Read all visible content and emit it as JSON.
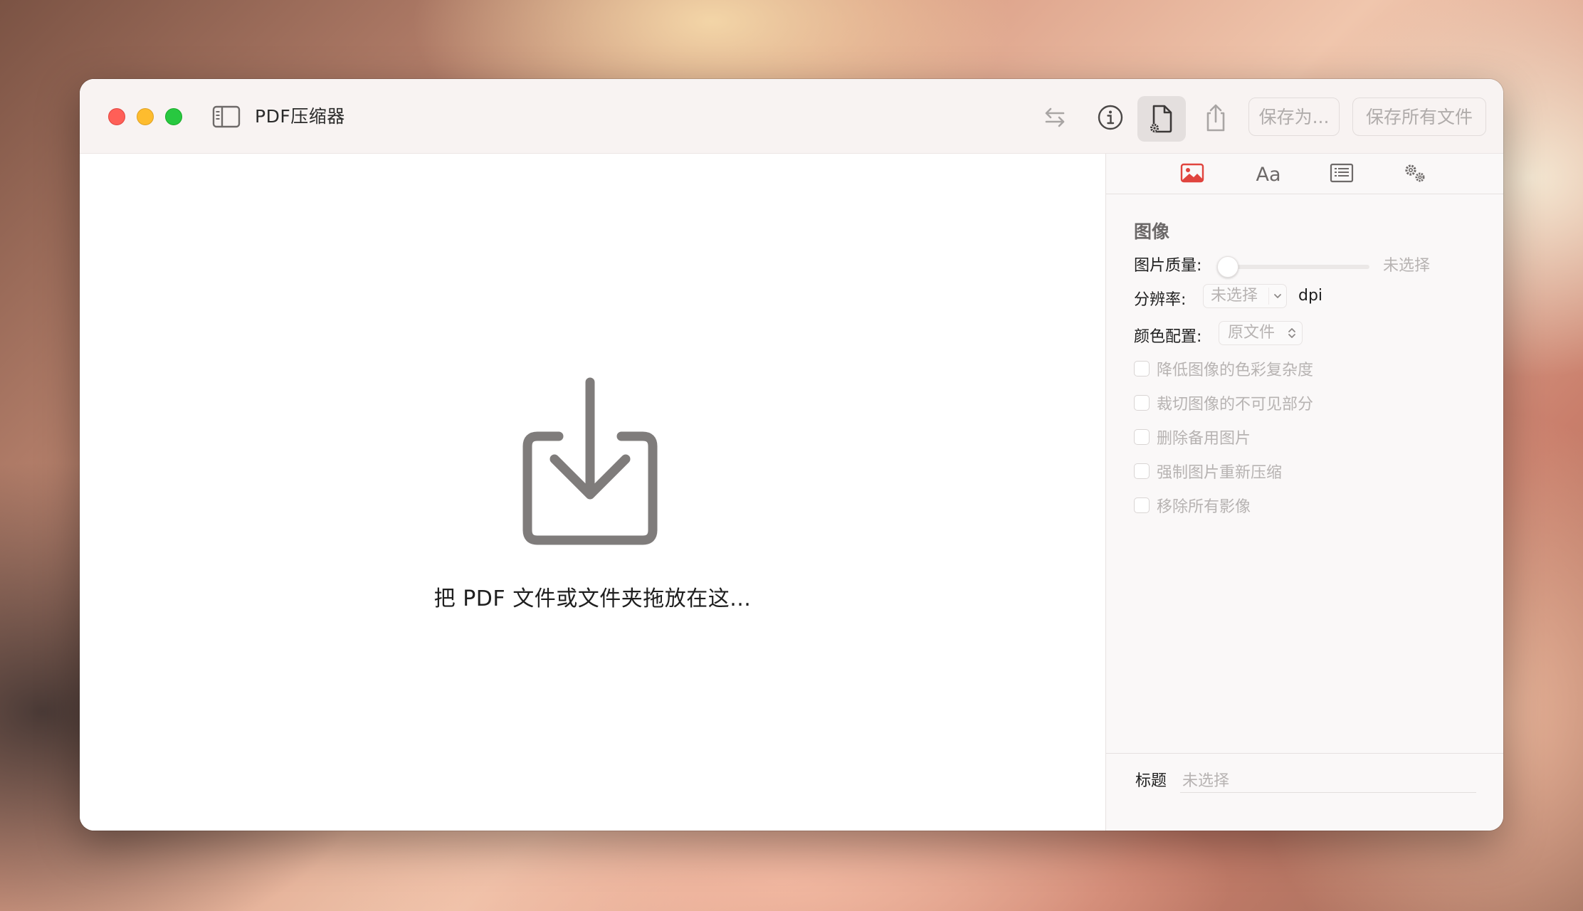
{
  "window": {
    "title": "PDF压缩器"
  },
  "toolbar": {
    "save_as_label": "保存为...",
    "save_all_label": "保存所有文件"
  },
  "dropzone": {
    "text": "把 PDF 文件或文件夹拖放在这..."
  },
  "inspector": {
    "tabs": [
      {
        "icon": "image-icon",
        "active": true
      },
      {
        "label": "Aa",
        "icon": "font-icon"
      },
      {
        "icon": "text-list-icon"
      },
      {
        "icon": "gears-icon"
      }
    ],
    "section_title": "图像",
    "image_quality": {
      "label": "图片质量:",
      "value": "未选择"
    },
    "resolution": {
      "label": "分辨率:",
      "value": "未选择",
      "unit": "dpi"
    },
    "color_profile": {
      "label": "颜色配置:",
      "value": "原文件"
    },
    "checkboxes": [
      "降低图像的色彩复杂度",
      "裁切图像的不可见部分",
      "删除备用图片",
      "强制图片重新压缩",
      "移除所有影像"
    ],
    "title_field": {
      "label": "标题",
      "placeholder": "未选择"
    }
  },
  "colors": {
    "accent": "#e0443e",
    "close": "#ff5f57",
    "minimize": "#febc2e",
    "zoom": "#28c840"
  }
}
